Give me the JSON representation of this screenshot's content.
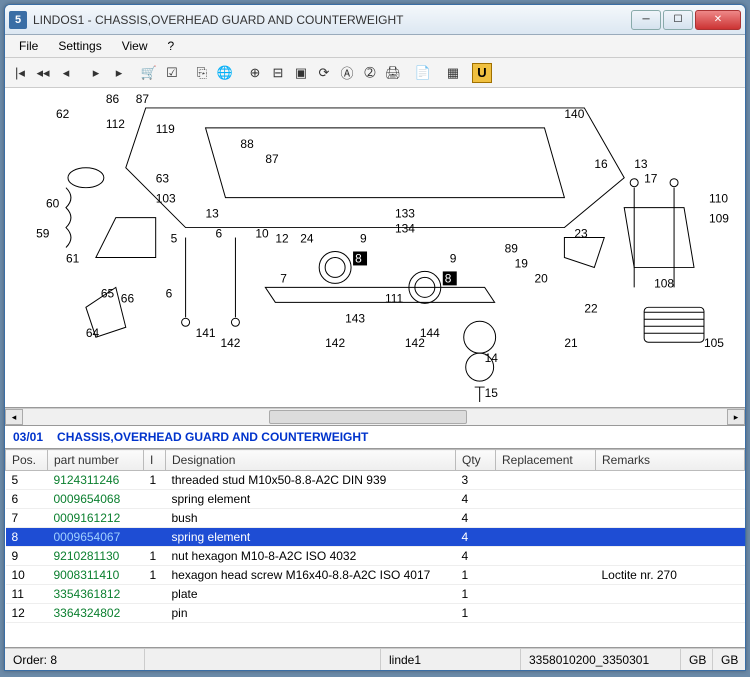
{
  "window": {
    "title": "LINDOS1 - CHASSIS,OVERHEAD GUARD AND COUNTERWEIGHT",
    "app_icon": "5"
  },
  "menu": {
    "file": "File",
    "settings": "Settings",
    "view": "View",
    "help": "?"
  },
  "toolbar_icons": {
    "first": "|◂",
    "rewind": "◂◂",
    "prev": "◂",
    "up": "▸",
    "down": "▸",
    "cart": "🛒",
    "check": "☑",
    "nav": "⎘",
    "globe": "🌐",
    "zoom_in": "⊕",
    "zoom_out": "⊟",
    "fit": "▣",
    "refresh": "⟳",
    "marker": "Ⓐ",
    "find": "➁",
    "print": "🖨",
    "page": "📄",
    "block": "▦",
    "u": "U"
  },
  "section": {
    "code": "03/01",
    "title": "CHASSIS,OVERHEAD GUARD AND COUNTERWEIGHT"
  },
  "columns": {
    "pos": "Pos.",
    "pn": "part number",
    "i": "I",
    "des": "Designation",
    "qty": "Qty",
    "rep": "Replacement",
    "rem": "Remarks"
  },
  "rows": [
    {
      "pos": "5",
      "pn": "9124311246",
      "i": "1",
      "des": "threaded stud M10x50-8.8-A2C  DIN 939",
      "qty": "3",
      "rep": "",
      "rem": "",
      "selected": false
    },
    {
      "pos": "6",
      "pn": "0009654068",
      "i": "",
      "des": "spring element",
      "qty": "4",
      "rep": "",
      "rem": "",
      "selected": false
    },
    {
      "pos": "7",
      "pn": "0009161212",
      "i": "",
      "des": "bush",
      "qty": "4",
      "rep": "",
      "rem": "",
      "selected": false
    },
    {
      "pos": "8",
      "pn": "0009654067",
      "i": "",
      "des": "spring element",
      "qty": "4",
      "rep": "",
      "rem": "",
      "selected": true
    },
    {
      "pos": "9",
      "pn": "9210281130",
      "i": "1",
      "des": "nut hexagon M10-8-A2C  ISO 4032",
      "qty": "4",
      "rep": "",
      "rem": "",
      "selected": false
    },
    {
      "pos": "10",
      "pn": "9008311410",
      "i": "1",
      "des": "hexagon head screw M16x40-8.8-A2C  ISO 4017",
      "qty": "1",
      "rep": "",
      "rem": "Loctite nr. 270",
      "selected": false
    },
    {
      "pos": "11",
      "pn": "3354361812",
      "i": "",
      "des": "plate",
      "qty": "1",
      "rep": "",
      "rem": "",
      "selected": false
    },
    {
      "pos": "12",
      "pn": "3364324802",
      "i": "",
      "des": "pin",
      "qty": "1",
      "rep": "",
      "rem": "",
      "selected": false
    }
  ],
  "diagram_labels": [
    "62",
    "86",
    "87",
    "112",
    "119",
    "88",
    "87",
    "133",
    "134",
    "140",
    "16",
    "13",
    "17",
    "110",
    "109",
    "108",
    "105",
    "23",
    "89",
    "21",
    "22",
    "20",
    "19",
    "9",
    "9",
    "8",
    "8",
    "111",
    "141",
    "142",
    "142",
    "142",
    "143",
    "144",
    "6",
    "13",
    "14",
    "15",
    "103",
    "63",
    "61",
    "59",
    "60",
    "65",
    "66",
    "64",
    "5",
    "6",
    "10",
    "12",
    "24",
    "7"
  ],
  "status": {
    "order": "Order: 8",
    "user": "linde1",
    "code": "3358010200_3350301",
    "lang1": "GB",
    "lang2": "GB"
  }
}
